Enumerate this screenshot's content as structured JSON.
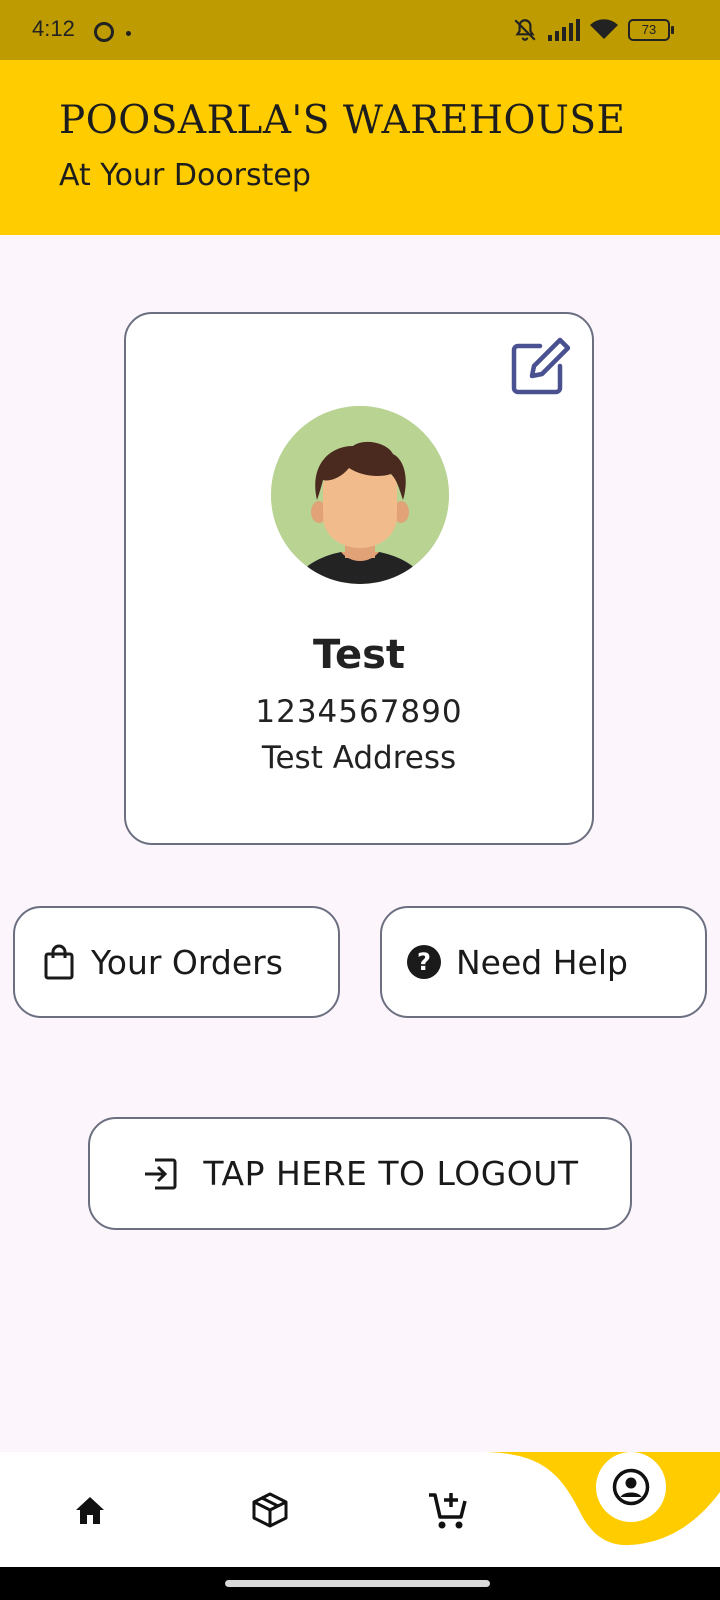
{
  "status_bar": {
    "time": "4:12",
    "battery": "73"
  },
  "header": {
    "title": "POOSARLA'S WAREHOUSE",
    "subtitle": "At Your Doorstep",
    "background": "#FFCC00"
  },
  "profile": {
    "name": "Test",
    "phone": "1234567890",
    "address": "Test Address",
    "edit_icon": "edit-icon",
    "avatar_icon": "avatar-placeholder"
  },
  "actions": {
    "orders_label": "Your Orders",
    "orders_icon": "shopping-bag-icon",
    "help_label": "Need Help",
    "help_icon": "help-circle-icon",
    "logout_label": "TAP HERE TO LOGOUT",
    "logout_icon": "logout-icon"
  },
  "bottom_nav": {
    "items": [
      {
        "icon": "home-icon"
      },
      {
        "icon": "box-icon"
      },
      {
        "icon": "add-cart-icon"
      },
      {
        "icon": "account-icon",
        "active": true
      }
    ],
    "accent": "#FFCC00"
  }
}
